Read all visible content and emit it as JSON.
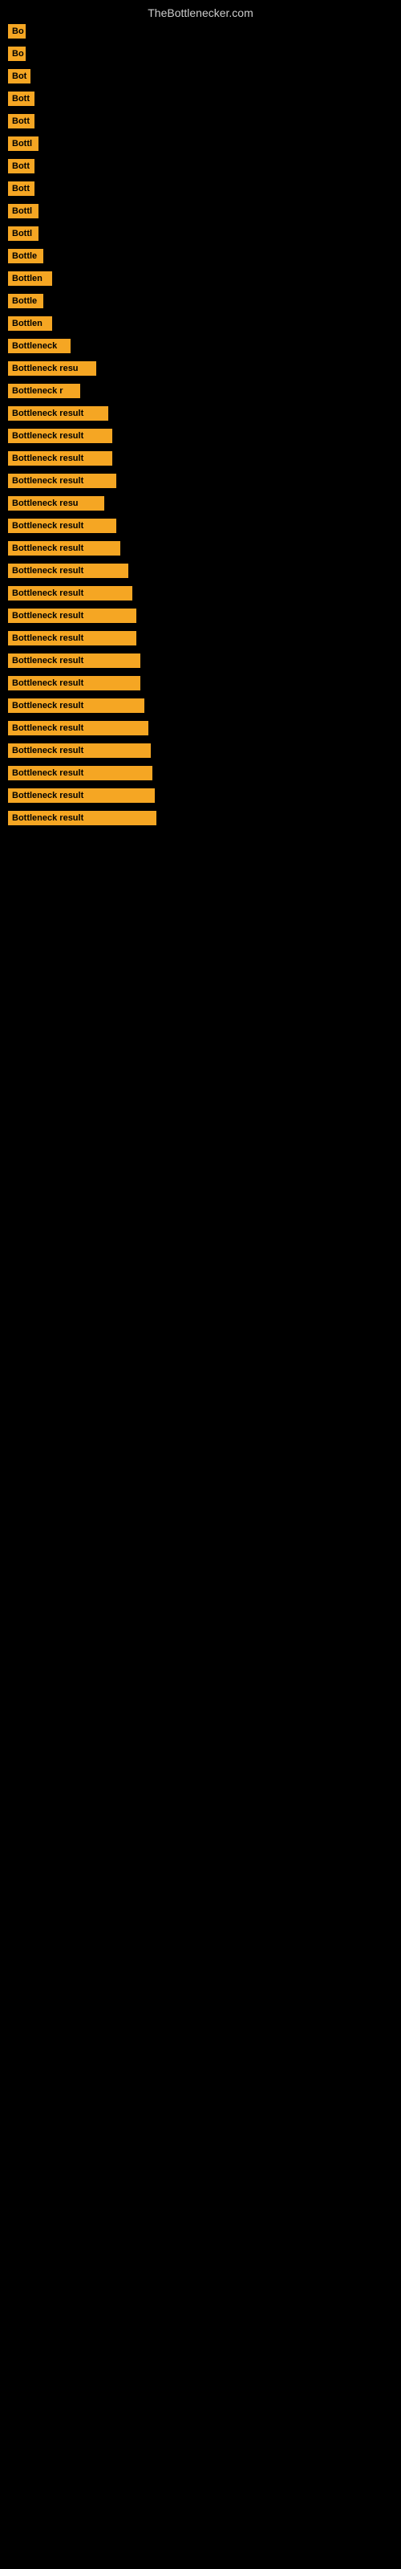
{
  "site": {
    "title": "TheBottlenecker.com"
  },
  "items": [
    {
      "id": 1,
      "label": "Bo",
      "width": 22
    },
    {
      "id": 2,
      "label": "Bo",
      "width": 22
    },
    {
      "id": 3,
      "label": "Bot",
      "width": 28
    },
    {
      "id": 4,
      "label": "Bott",
      "width": 33
    },
    {
      "id": 5,
      "label": "Bott",
      "width": 33
    },
    {
      "id": 6,
      "label": "Bottl",
      "width": 38
    },
    {
      "id": 7,
      "label": "Bott",
      "width": 33
    },
    {
      "id": 8,
      "label": "Bott",
      "width": 33
    },
    {
      "id": 9,
      "label": "Bottl",
      "width": 38
    },
    {
      "id": 10,
      "label": "Bottl",
      "width": 38
    },
    {
      "id": 11,
      "label": "Bottle",
      "width": 44
    },
    {
      "id": 12,
      "label": "Bottlen",
      "width": 55
    },
    {
      "id": 13,
      "label": "Bottle",
      "width": 44
    },
    {
      "id": 14,
      "label": "Bottlen",
      "width": 55
    },
    {
      "id": 15,
      "label": "Bottleneck",
      "width": 78
    },
    {
      "id": 16,
      "label": "Bottleneck resu",
      "width": 110
    },
    {
      "id": 17,
      "label": "Bottleneck r",
      "width": 90
    },
    {
      "id": 18,
      "label": "Bottleneck result",
      "width": 125
    },
    {
      "id": 19,
      "label": "Bottleneck result",
      "width": 130
    },
    {
      "id": 20,
      "label": "Bottleneck result",
      "width": 130
    },
    {
      "id": 21,
      "label": "Bottleneck result",
      "width": 135
    },
    {
      "id": 22,
      "label": "Bottleneck resu",
      "width": 120
    },
    {
      "id": 23,
      "label": "Bottleneck result",
      "width": 135
    },
    {
      "id": 24,
      "label": "Bottleneck result",
      "width": 140
    },
    {
      "id": 25,
      "label": "Bottleneck result",
      "width": 150
    },
    {
      "id": 26,
      "label": "Bottleneck result",
      "width": 155
    },
    {
      "id": 27,
      "label": "Bottleneck result",
      "width": 160
    },
    {
      "id": 28,
      "label": "Bottleneck result",
      "width": 160
    },
    {
      "id": 29,
      "label": "Bottleneck result",
      "width": 165
    },
    {
      "id": 30,
      "label": "Bottleneck result",
      "width": 165
    },
    {
      "id": 31,
      "label": "Bottleneck result",
      "width": 170
    },
    {
      "id": 32,
      "label": "Bottleneck result",
      "width": 175
    },
    {
      "id": 33,
      "label": "Bottleneck result",
      "width": 178
    },
    {
      "id": 34,
      "label": "Bottleneck result",
      "width": 180
    },
    {
      "id": 35,
      "label": "Bottleneck result",
      "width": 183
    },
    {
      "id": 36,
      "label": "Bottleneck result",
      "width": 185
    }
  ]
}
